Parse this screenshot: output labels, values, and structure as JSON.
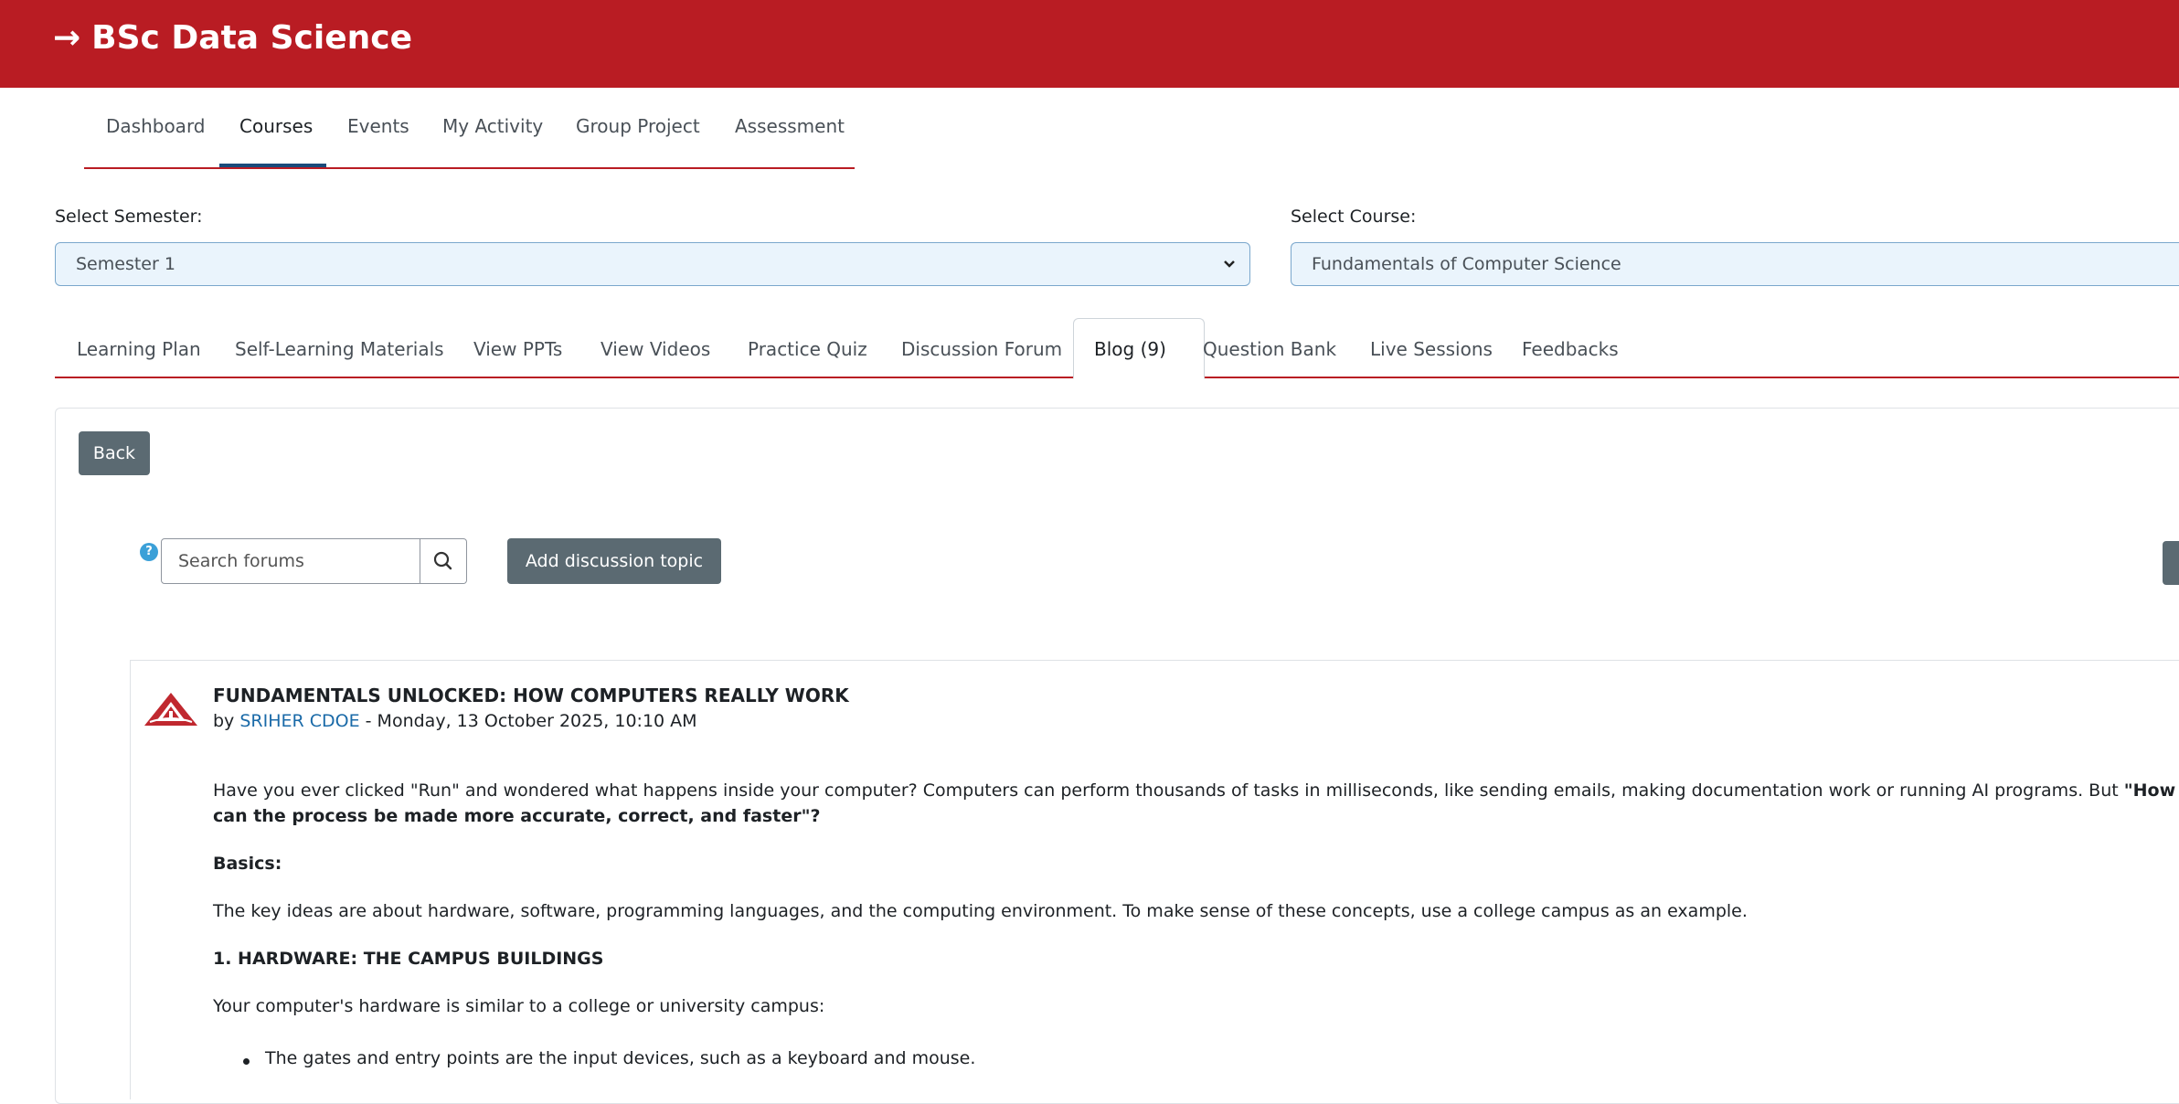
{
  "header": {
    "title": "BSc Data Science",
    "arrow": "→"
  },
  "main_nav": [
    "Dashboard",
    "Courses",
    "Events",
    "My Activity",
    "Group Project",
    "Assessment"
  ],
  "semester": {
    "label": "Select Semester:",
    "value": "Semester 1"
  },
  "course": {
    "label": "Select Course:",
    "value": "Fundamentals of Computer Science"
  },
  "course_tabs": [
    "Learning Plan",
    "Self-Learning Materials",
    "View PPTs",
    "View Videos",
    "Practice Quiz",
    "Discussion Forum",
    "Blog (9)",
    "Question Bank",
    "Live Sessions",
    "Feedbacks"
  ],
  "active_tab": "Blog (9)",
  "actions": {
    "back_label": "Back",
    "search_placeholder": "Search forums",
    "add_topic_label": "Add discussion topic",
    "help_glyph": "?"
  },
  "post": {
    "title": "FUNDAMENTALS UNLOCKED: HOW COMPUTERS REALLY WORK",
    "by": "by",
    "author": "SRIHER CDOE",
    "date": " - Monday, 13 October 2025, 10:10 AM",
    "intro_1a": "Have you ever clicked \"Run\" and wondered what happens inside your computer? Computers can perform thousands of tasks in milliseconds, like sending emails, making documentation work or running AI programs. But ",
    "intro_1b": "\"How do the",
    "intro_2": "can the process be made more accurate, correct, and faster\"?",
    "basics_heading": "Basics:",
    "basics_text": "The key ideas are about hardware, software, programming languages, and the computing environment. To make sense of these concepts, use a college campus as an example.",
    "section_1_heading": "1. HARDWARE: THE CAMPUS BUILDINGS",
    "section_1_text": "Your computer's hardware is similar to a college or university campus:",
    "bullet_1": "The gates and entry points are the input devices, such as a keyboard and mouse."
  }
}
